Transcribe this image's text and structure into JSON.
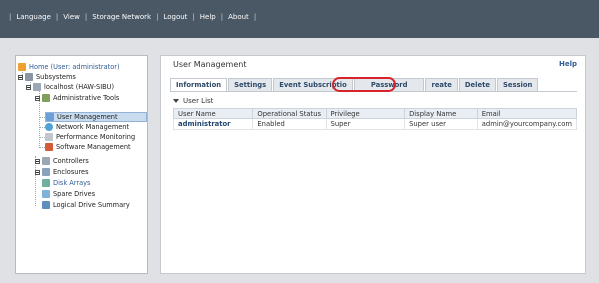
{
  "menu": {
    "items": [
      "Language",
      "View",
      "Storage Network",
      "Logout",
      "Help",
      "About"
    ]
  },
  "tree": {
    "home": "Home (User: administrator)",
    "subsystems": "Subsystems",
    "host": "localhost (HAW-SIBU)",
    "admin_tools": "Administrative Tools",
    "user_mgmt": "User Management",
    "network_mgmt": "Network Management",
    "perf_mon": "Performance Monitoring",
    "software_mgmt": "Software Management",
    "controllers": "Controllers",
    "enclosures": "Enclosures",
    "disk_arrays": "Disk Arrays",
    "spare_drives": "Spare Drives",
    "logical_summary": "Logical Drive Summary"
  },
  "panel": {
    "title": "User Management",
    "help": "Help",
    "tabs": [
      "Information",
      "Settings",
      "Event Subscriptio",
      "Password",
      "reate",
      "Delete",
      "Session"
    ],
    "section": "User List",
    "columns": [
      "User Name",
      "Operational Status",
      "Privilege",
      "Display Name",
      "Email"
    ],
    "rows": [
      [
        "administrator",
        "Enabled",
        "Super",
        "Super user",
        "admin@yourcompany.com"
      ]
    ]
  },
  "colors": {
    "topbar": "#4a5866",
    "highlight": "#d8232a"
  }
}
